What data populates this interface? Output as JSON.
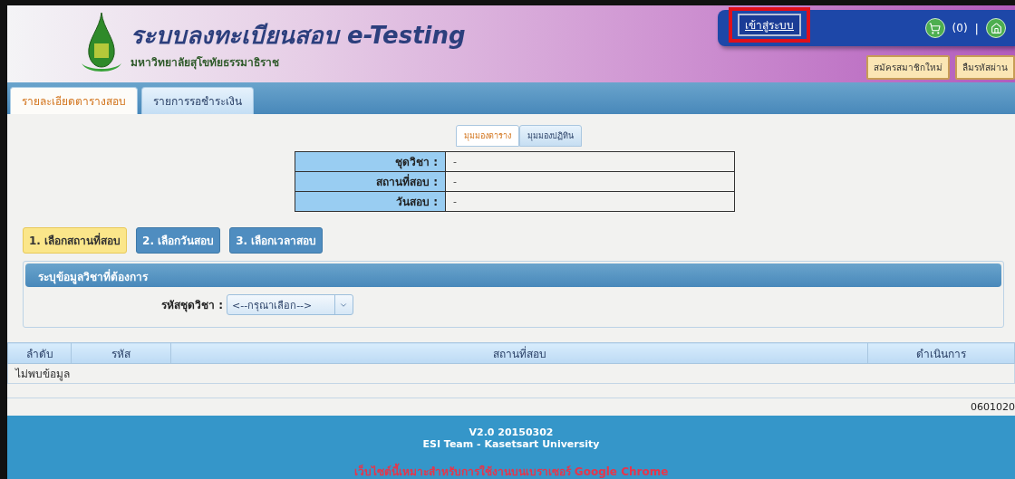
{
  "header": {
    "title": "ระบบลงทะเบียนสอบ e-Testing",
    "subtitle": "มหาวิทยาลัยสุโขทัยธรรมาธิราช",
    "login_button": "เข้าสู่ระบบ",
    "login_highlighted": true,
    "cart_count": "(0)",
    "separator": "|",
    "account_buttons": [
      "สมัครสมาชิกใหม่",
      "ลืมรหัสผ่าน"
    ]
  },
  "tabs": [
    {
      "label": "รายละเอียดตารางสอบ",
      "selected": true
    },
    {
      "label": "รายการรอชำระเงิน",
      "selected": false
    }
  ],
  "view_toggle": [
    {
      "label": "มุมมองตาราง",
      "selected": true
    },
    {
      "label": "มุมมองปฏิทิน",
      "selected": false
    }
  ],
  "summary": [
    {
      "label": "ชุดวิชา :",
      "value": "-"
    },
    {
      "label": "สถานที่สอบ :",
      "value": "-"
    },
    {
      "label": "วันสอบ :",
      "value": "-"
    }
  ],
  "steps": [
    {
      "label": "1. เลือกสถานที่สอบ",
      "selected": true
    },
    {
      "label": "2. เลือกวันสอบ",
      "selected": false
    },
    {
      "label": "3. เลือกเวลาสอบ",
      "selected": false
    }
  ],
  "course_panel": {
    "title": "ระบุข้อมูลวิชาที่ต้องการ",
    "field_label": "รหัสชุดวิชา :",
    "select_value": "<--กรุณาเลือก-->"
  },
  "table": {
    "columns": [
      "ลำดับ",
      "รหัส",
      "สถานที่สอบ",
      "ดำเนินการ"
    ],
    "empty_message": "ไม่พบข้อมูล"
  },
  "page_code": "0601020",
  "footer": {
    "version": "V2.0 20150302",
    "team": "ESI Team - Kasetsart University",
    "notice": "เว็บไซต์นี้เหมาะสำหรับการใช้งานบนเบราเซอร์ Google Chrome"
  }
}
